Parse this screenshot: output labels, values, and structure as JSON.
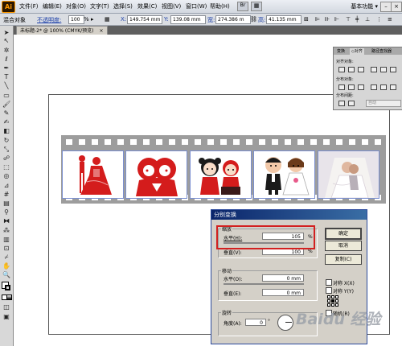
{
  "app": {
    "logo": "Ai",
    "workspace": "基本功能 ▾"
  },
  "menu": [
    "文件(F)",
    "编辑(E)",
    "对象(O)",
    "文字(T)",
    "选择(S)",
    "效果(C)",
    "视图(V)",
    "窗口(W)",
    "帮助(H)"
  ],
  "control_bar": {
    "object_label": "混合对象",
    "opacity_label": "不透明度:",
    "opacity_value": "100",
    "opacity_unit": "%",
    "x_label": "X:",
    "x_value": "149.754 mm",
    "y_label": "Y:",
    "y_value": "139.08 mm",
    "w_label": "宽:",
    "w_value": "274.386 m",
    "h_label": "高:",
    "h_value": "41.135 mm"
  },
  "document_tab": {
    "label": "未标题-2* @ 100% (CMYK/预览)",
    "close": "×"
  },
  "panel": {
    "tabs": [
      "变换",
      "◇对齐",
      "路径查找器"
    ],
    "align_objects": "对齐对象:",
    "distribute_objects": "分布对象:",
    "distribute_spacing": "分布间距:",
    "auto_value": "自动"
  },
  "dialog": {
    "title": "分别变换",
    "scale": {
      "label": "缩放",
      "horizontal_label": "水平(H):",
      "horizontal_value": "105",
      "horizontal_unit": "%",
      "vertical_label": "垂直(V):",
      "vertical_value": "100",
      "vertical_unit": "%"
    },
    "move": {
      "label": "移动",
      "horizontal_label": "水平(O):",
      "horizontal_value": "0 mm",
      "vertical_label": "垂直(E):",
      "vertical_value": "0 mm"
    },
    "rotate": {
      "label": "旋转",
      "angle_label": "角度(A):",
      "angle_value": "0",
      "angle_unit": "°"
    },
    "buttons": {
      "ok": "确定",
      "cancel": "取消",
      "copy": "复制(C)"
    },
    "options": {
      "reflect_x": "对称 X(X)",
      "reflect_y": "对称 Y(Y)",
      "random": "随机(R)"
    }
  },
  "watermark": "Baidu 经验"
}
